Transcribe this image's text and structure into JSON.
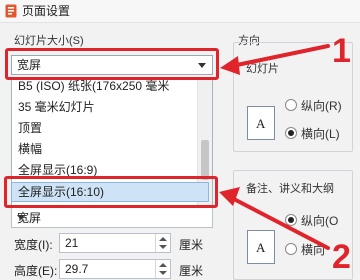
{
  "window": {
    "title": "页面设置"
  },
  "slide_size": {
    "label": "幻灯片大小(S)",
    "selected": "宽屏",
    "options": [
      "B5 (ISO) 纸张(176x250 毫米",
      "35 毫米幻灯片",
      "顶置",
      "横幅",
      "全屏显示(16:9)"
    ],
    "highlighted": "全屏显示(16:10)",
    "lower_value": "宽屏"
  },
  "width": {
    "label": "宽度(I):",
    "value": "21",
    "unit": "厘米"
  },
  "height": {
    "label": "高度(E):",
    "value": "29.7",
    "unit": "厘米"
  },
  "orientation": {
    "section_label": "方向",
    "slides_label": "幻灯片",
    "portrait_label": "纵向(R)",
    "landscape_label": "横向(L)",
    "notes_label": "备注、讲义和大纲",
    "notes_portrait_label": "纵向(O",
    "notes_landscape_label": "横向",
    "page_icon_letter": "A"
  },
  "annotations": {
    "badge_1": "1",
    "badge_2": "2"
  },
  "colors": {
    "annotation_red": "#e0242b",
    "highlight": "#cfe3f7"
  }
}
